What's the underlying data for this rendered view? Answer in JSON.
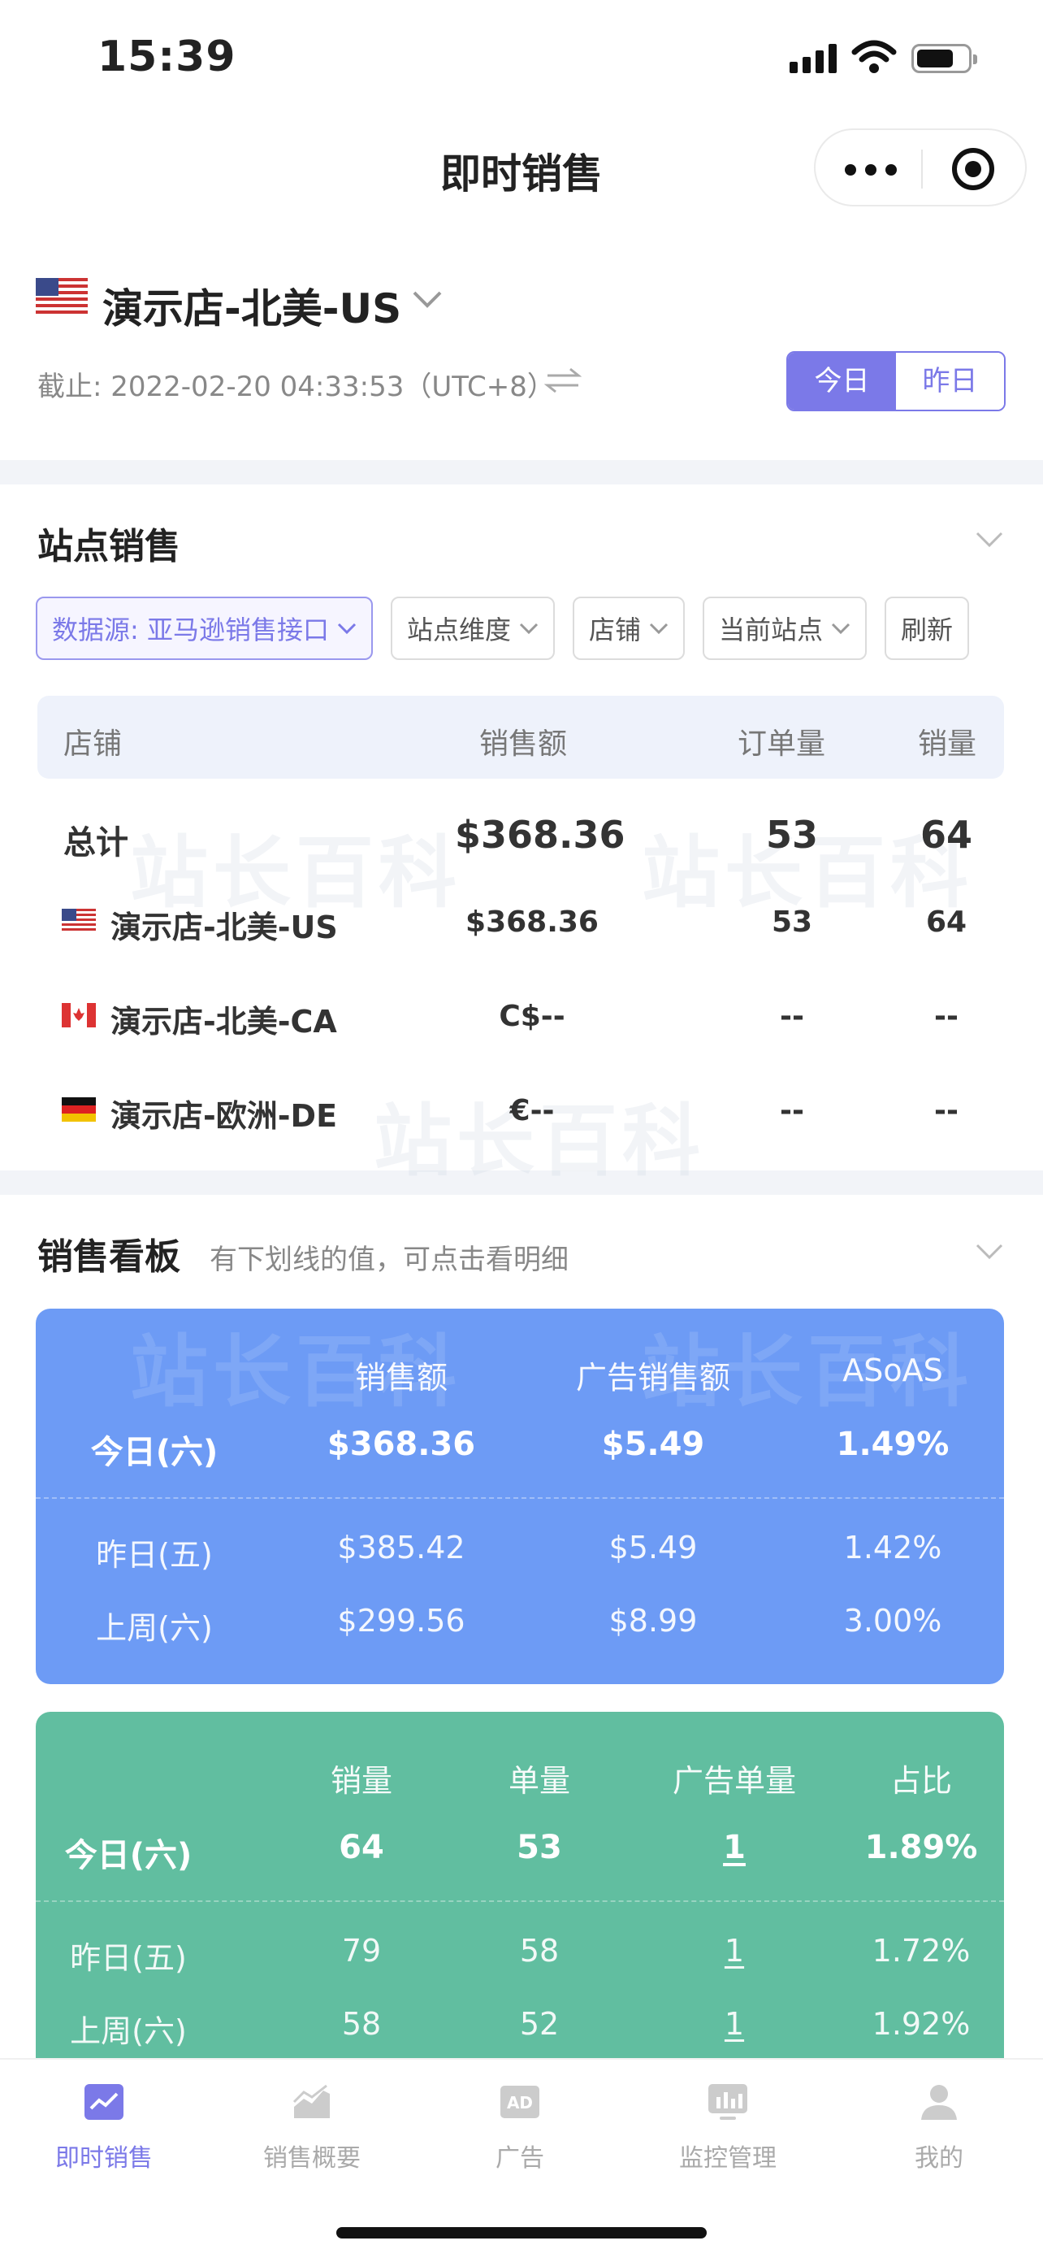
{
  "status_bar": {
    "time": "15:39"
  },
  "nav": {
    "title": "即时销售"
  },
  "header": {
    "store_name": "演示店-北美-US",
    "cutoff_text": "截止: 2022-02-20 04:33:53（UTC+8）",
    "toggle": {
      "today": "今日",
      "yesterday": "昨日"
    }
  },
  "site_sales": {
    "title": "站点销售",
    "filters": [
      "数据源: 亚马逊销售接口",
      "站点维度",
      "店铺",
      "当前站点",
      "刷新"
    ],
    "columns": [
      "店铺",
      "销售额",
      "订单量",
      "销量"
    ],
    "total": {
      "label": "总计",
      "sales": "$368.36",
      "orders": "53",
      "units": "64"
    },
    "rows": [
      {
        "store": "演示店-北美-US",
        "flag": "us-flag-icon",
        "sales": "$368.36",
        "orders": "53",
        "units": "64"
      },
      {
        "store": "演示店-北美-CA",
        "flag": "ca-flag-icon",
        "sales": "C$--",
        "orders": "--",
        "units": "--"
      },
      {
        "store": "演示店-欧洲-DE",
        "flag": "de-flag-icon",
        "sales": "€--",
        "orders": "--",
        "units": "--"
      }
    ],
    "watermark": "站长百科"
  },
  "dashboard": {
    "title": "销售看板",
    "hint": "有下划线的值，可点击看明细",
    "blue_panel": {
      "columns": [
        "销售额",
        "广告销售额",
        "ASoAS"
      ],
      "rows": [
        {
          "label": "今日(六)",
          "values": [
            "$368.36",
            "$5.49",
            "1.49%"
          ]
        },
        {
          "label": "昨日(五)",
          "values": [
            "$385.42",
            "$5.49",
            "1.42%"
          ]
        },
        {
          "label": "上周(六)",
          "values": [
            "$299.56",
            "$8.99",
            "3.00%"
          ]
        }
      ]
    },
    "green_panel": {
      "columns": [
        "销量",
        "单量",
        "广告单量",
        "占比"
      ],
      "rows": [
        {
          "label": "今日(六)",
          "values": [
            "64",
            "53",
            "1",
            "1.89%"
          ]
        },
        {
          "label": "昨日(五)",
          "values": [
            "79",
            "58",
            "1",
            "1.72%"
          ]
        },
        {
          "label": "上周(六)",
          "values": [
            "58",
            "52",
            "1",
            "1.92%"
          ]
        }
      ]
    }
  },
  "tabbar": {
    "tabs": [
      {
        "label": "即时销售",
        "icon": "realtime-chart-icon",
        "active": true
      },
      {
        "label": "销售概要",
        "icon": "area-chart-icon",
        "active": false
      },
      {
        "label": "广告",
        "icon": "ad-icon",
        "active": false
      },
      {
        "label": "监控管理",
        "icon": "monitor-icon",
        "active": false
      },
      {
        "label": "我的",
        "icon": "profile-icon",
        "active": false
      }
    ]
  },
  "colors": {
    "accent": "#7b79e8",
    "blue_panel": "#6d9bf5",
    "green_panel": "#61bea0",
    "background": "#f2f4f8"
  }
}
